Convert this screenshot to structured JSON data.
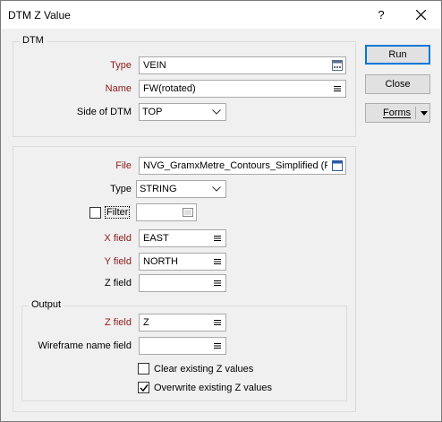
{
  "window": {
    "title": "DTM Z Value",
    "help_label": "?"
  },
  "buttons": {
    "run": "Run",
    "close": "Close",
    "forms": "Forms"
  },
  "dtm_group": {
    "legend": "DTM",
    "type_label": "Type",
    "type_value": "VEIN",
    "name_label": "Name",
    "name_value": "FW(rotated)",
    "side_label": "Side of DTM",
    "side_value": "TOP"
  },
  "input_group": {
    "file_label": "File",
    "file_value": "NVG_GramxMetre_Contours_Simplified (PO",
    "type_label": "Type",
    "type_value": "STRING",
    "filter_label": "Filter",
    "filter_checked": false,
    "filter_value": "",
    "x_field_label": "X field",
    "x_field_value": "EAST",
    "y_field_label": "Y field",
    "y_field_value": "NORTH",
    "z_field_label": "Z field",
    "z_field_value": ""
  },
  "output_group": {
    "legend": "Output",
    "z_field_label": "Z field",
    "z_field_value": "Z",
    "wireframe_label": "Wireframe name field",
    "wireframe_value": "",
    "clear_label": "Clear existing  Z values",
    "clear_checked": false,
    "overwrite_label": "Overwrite existing Z values",
    "overwrite_checked": true
  },
  "colors": {
    "required_label": "#8b1a1a",
    "default_button_border": "#0078d7",
    "dialog_bg": "#f0f0f0"
  },
  "icons": {
    "browse": "ellipsis-browse-icon",
    "list": "list-picker-icon",
    "file_browse": "file-browse-icon",
    "filter_browse": "filter-browse-icon",
    "dropdown": "chevron-down-icon",
    "close": "close-icon",
    "check": "checkmark-icon"
  }
}
